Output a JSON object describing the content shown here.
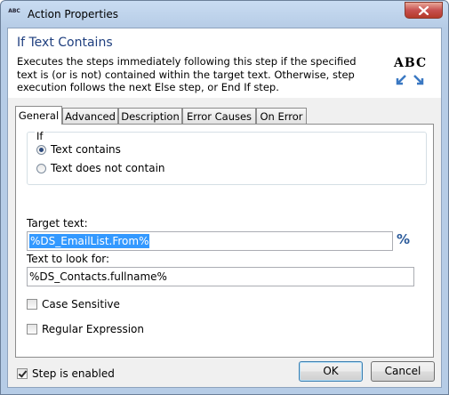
{
  "window": {
    "title": "Action Properties",
    "icon_text": "ABC"
  },
  "header": {
    "title": "If Text Contains",
    "description": "Executes the steps immediately following this step if the specified text is (or is not)  contained within the target text.  Otherwise, step execution follows the next Else step, or End If step.",
    "logo_text": "ABC"
  },
  "tabs": [
    {
      "label": "General",
      "active": true
    },
    {
      "label": "Advanced",
      "active": false
    },
    {
      "label": "Description",
      "active": false
    },
    {
      "label": "Error Causes",
      "active": false
    },
    {
      "label": "On Error",
      "active": false
    }
  ],
  "general": {
    "group_label": "If",
    "radio_options": [
      {
        "label": "Text contains",
        "selected": true
      },
      {
        "label": "Text does not contain",
        "selected": false
      }
    ],
    "target_text_label": "Target text:",
    "target_text_value": "%DS_EmailList.From%",
    "variable_button": "%",
    "look_for_label": "Text to look for:",
    "look_for_value": "%DS_Contacts.fullname%",
    "case_sensitive_label": "Case Sensitive",
    "case_sensitive_checked": false,
    "regex_label": "Regular Expression",
    "regex_checked": false
  },
  "footer": {
    "step_enabled_label": "Step is enabled",
    "step_enabled_checked": true,
    "ok_label": "OK",
    "cancel_label": "Cancel"
  },
  "colors": {
    "title_blue": "#1f3f7f",
    "selection": "#3399ff",
    "close_red": "#c75050"
  }
}
